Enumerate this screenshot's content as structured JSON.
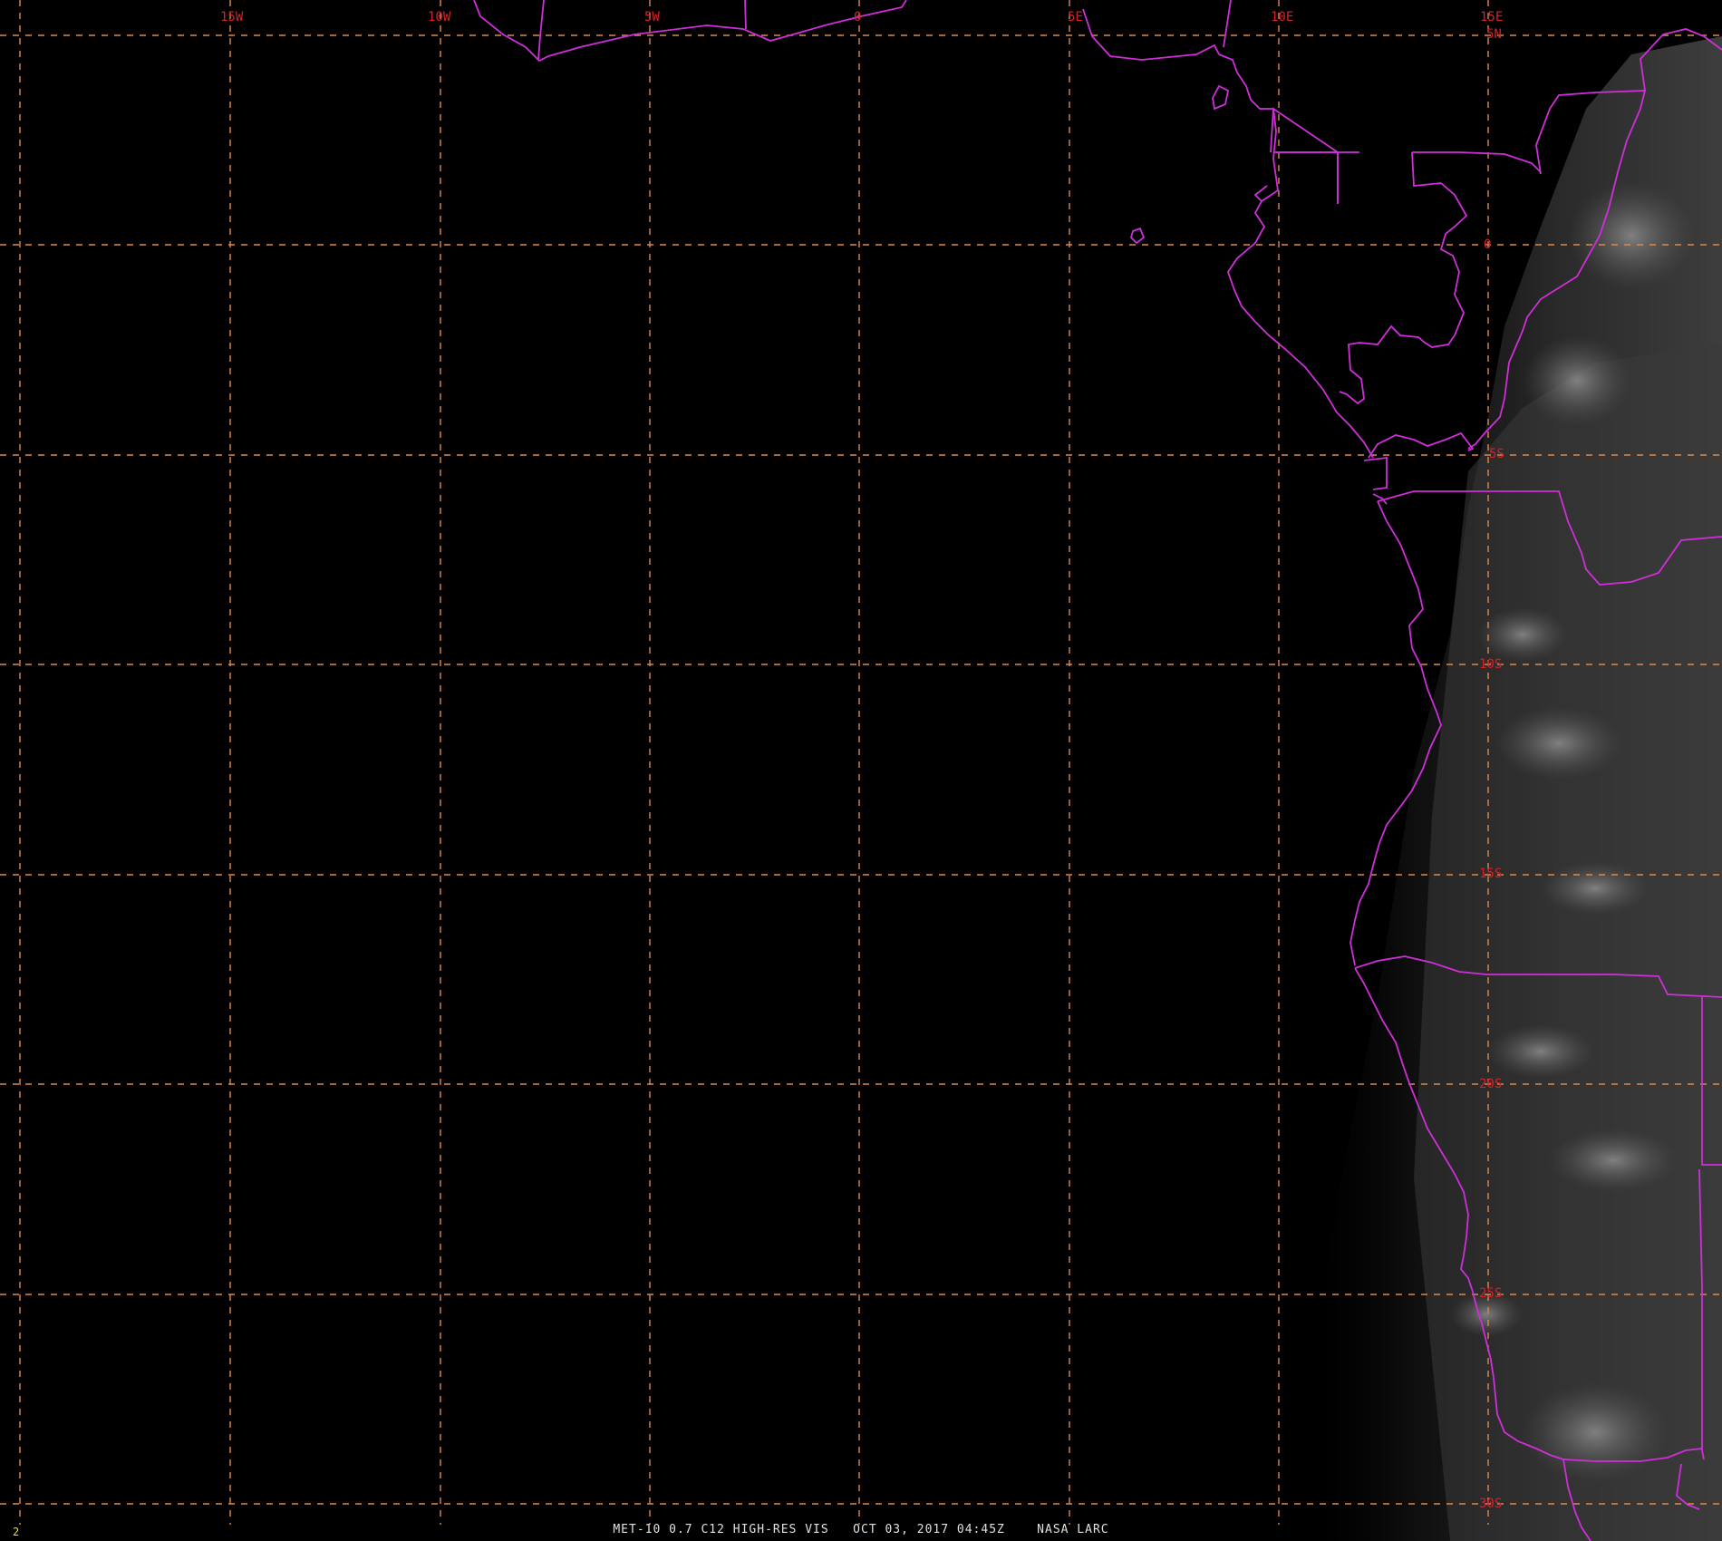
{
  "caption": {
    "product": "MET-10 0.7 C12 HIGH-RES VIS",
    "datetime": "OCT 03, 2017 04:45Z",
    "source": "NASA LARC",
    "full": "MET-10 0.7 C12 HIGH-RES VIS   OCT 03, 2017 04:45Z    NASA LARC"
  },
  "frame_number": "2",
  "longitude_labels": [
    "15W",
    "10W",
    "5W",
    "0",
    "5E",
    "10E",
    "15E"
  ],
  "latitude_labels": [
    "5N",
    "0",
    "5S",
    "10S",
    "15S",
    "20S",
    "25S",
    "30S"
  ],
  "colors": {
    "background": "#000000",
    "grid": "#d88a52",
    "borders": "#cf2fd8",
    "labels": "#d3222a",
    "caption": "#e0e0e0",
    "frame_number": "#e6e600"
  },
  "map": {
    "type": "satellite visible imagery with lat/lon grid and political boundaries",
    "lon_range": [
      "20W",
      "20E"
    ],
    "lat_range": [
      "6N",
      "31S"
    ]
  }
}
